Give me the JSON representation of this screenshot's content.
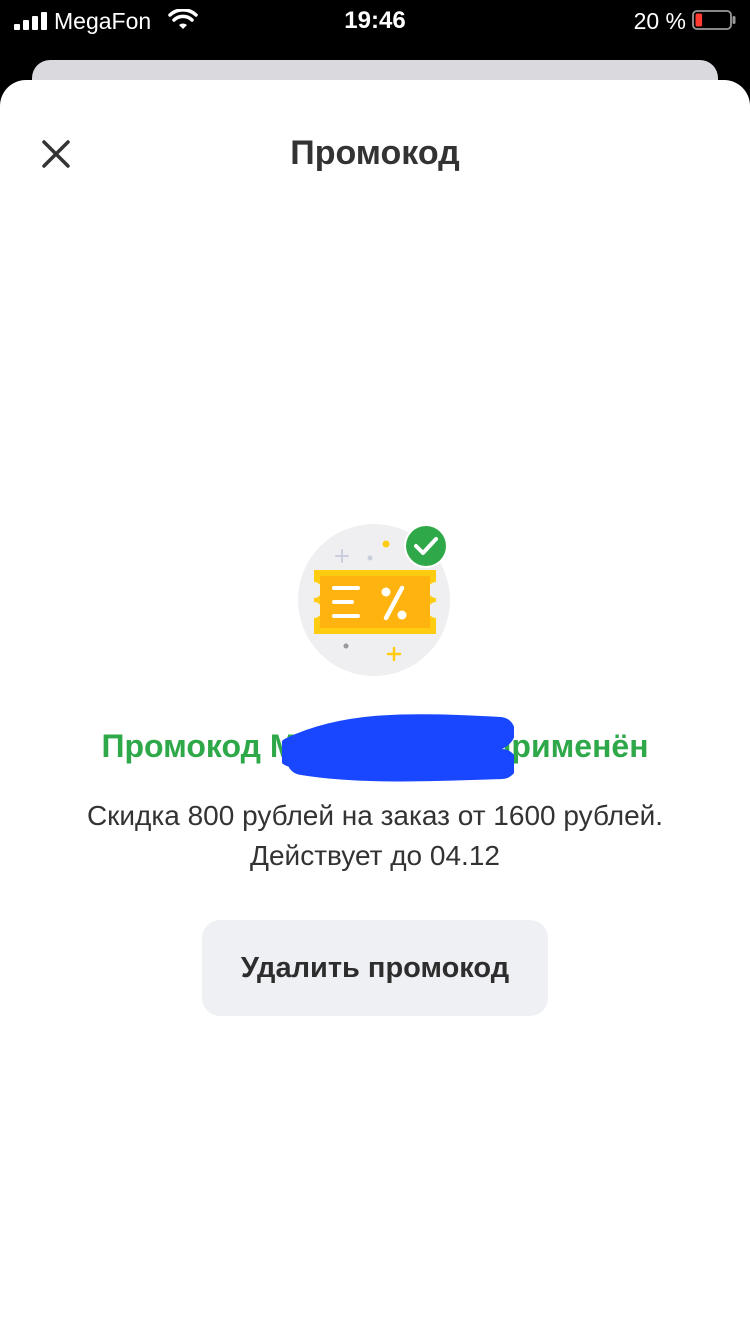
{
  "status_bar": {
    "carrier": "MegaFon",
    "time": "19:46",
    "battery_percent": "20 %",
    "battery_level": 0.2,
    "icons": [
      "signal-icon",
      "wifi-icon",
      "battery-icon"
    ]
  },
  "header": {
    "title": "Промокод",
    "close_icon": "close-icon"
  },
  "promo": {
    "status_text": "Промокод М                      применён",
    "description_line1": "Скидка 800 рублей на заказ от 1600 рублей.",
    "description_line2": "Действует до 04.12",
    "remove_label": "Удалить промокод",
    "illustration_icon": "coupon-percent-icon",
    "check_icon": "check-circle-icon"
  },
  "colors": {
    "success": "#2fa84a",
    "coupon": "#ffcc11",
    "redaction": "#1847ff"
  }
}
